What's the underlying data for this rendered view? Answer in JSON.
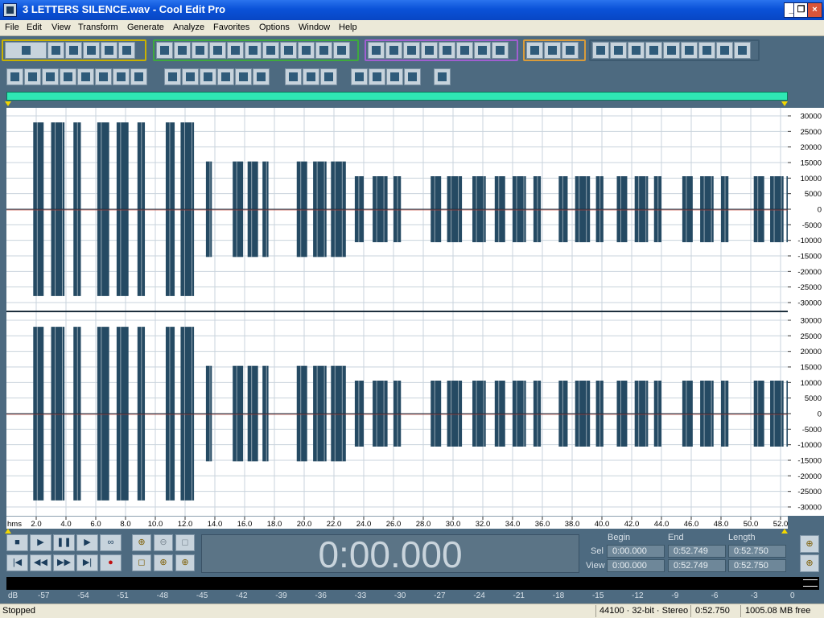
{
  "window": {
    "title": "3 LETTERS SILENCE.wav - Cool Edit Pro",
    "minimize": "_",
    "restore": "❐",
    "close": "×"
  },
  "menu": [
    "File",
    "Edit",
    "View",
    "Transform",
    "Generate",
    "Analyze",
    "Favorites",
    "Options",
    "Window",
    "Help"
  ],
  "amplitude_scale": {
    "labels": [
      "30000",
      "25000",
      "20000",
      "15000",
      "10000",
      "5000",
      "0",
      "-5000",
      "-10000",
      "-15000",
      "-20000",
      "-25000",
      "-30000"
    ]
  },
  "time_ruler": {
    "unit": "hms",
    "labels": [
      "2.0",
      "4.0",
      "6.0",
      "8.0",
      "10.0",
      "12.0",
      "14.0",
      "16.0",
      "18.0",
      "20.0",
      "22.0",
      "24.0",
      "26.0",
      "28.0",
      "30.0",
      "32.0",
      "34.0",
      "36.0",
      "38.0",
      "40.0",
      "42.0",
      "44.0",
      "46.0",
      "48.0",
      "50.0",
      "52.0"
    ]
  },
  "time_display": "0:00.000",
  "selection": {
    "headers": {
      "begin": "Begin",
      "end": "End",
      "length": "Length"
    },
    "sel": {
      "label": "Sel",
      "begin": "0:00.000",
      "end": "0:52.749",
      "length": "0:52.750"
    },
    "view": {
      "label": "View",
      "begin": "0:00.000",
      "end": "0:52.749",
      "length": "0:52.750"
    }
  },
  "level_meter": {
    "unit": "dB",
    "labels": [
      "-57",
      "-54",
      "-51",
      "-48",
      "-45",
      "-42",
      "-39",
      "-36",
      "-33",
      "-30",
      "-27",
      "-24",
      "-21",
      "-18",
      "-15",
      "-12",
      "-9",
      "-6",
      "-3",
      "0"
    ]
  },
  "status": {
    "state": "Stopped",
    "format": "44100 · 32-bit · Stereo",
    "length": "0:52.750",
    "free_space": "1005.08 MB free"
  },
  "colors": {
    "waveform": "#254a63",
    "background": "#4d6a80",
    "range_bar": "#2fe7b4"
  }
}
